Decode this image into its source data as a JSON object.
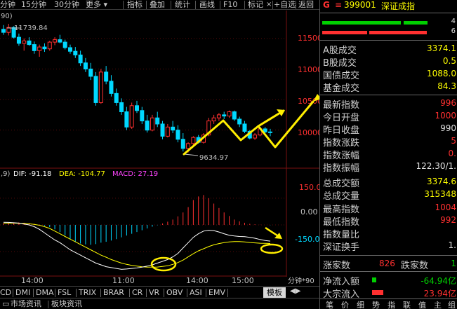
{
  "toolbar": {
    "items": [
      "分钟",
      "15分钟",
      "30分钟",
      "更多 ▾",
      "指标",
      "叠加",
      "统计",
      "画线",
      "F10",
      "标记",
      "+自选",
      "返回"
    ],
    "close_icon": "×"
  },
  "price_panel": {
    "period_label": "90)",
    "high_marker": "11739.84",
    "low_marker": "9634.97",
    "y_ticks": [
      "11500",
      "11000",
      "10500",
      "10000"
    ],
    "candle_up_color": "#ff3030",
    "candle_down_color": "#00d8ff"
  },
  "macd_panel": {
    "params": ",9)",
    "dif_label": "DIF: -91.18",
    "dea_label": "DEA: -104.77",
    "macd_label": "MACD: 27.19",
    "y_ticks": [
      "150.0",
      "0.00",
      "-150.0"
    ]
  },
  "x_axis": {
    "ticks": [
      "14:00",
      "11:00",
      "14:00",
      "15:00"
    ],
    "period_right": "分钟*90"
  },
  "indicator_tabs": [
    "CD",
    "DMI",
    "DMA",
    "FSL",
    "TRIX",
    "BRAR",
    "CR",
    "VR",
    "OBV",
    "ASI",
    "EMV"
  ],
  "template_button": "模板",
  "nav_arrows": "◀▶",
  "bottom_bar": {
    "items": [
      "市场资讯",
      "板块资讯"
    ]
  },
  "right_panel": {
    "indicator": "G",
    "menu_icon": "≡",
    "code": "399001",
    "name": "深证成指",
    "bar_counts": [
      "4",
      "6"
    ],
    "rows": [
      {
        "label": "A股成交",
        "value": "3374.1",
        "color": "#ffff00"
      },
      {
        "label": "B股成交",
        "value": "0.5",
        "color": "#ffff00"
      },
      {
        "label": "国债成交",
        "value": "1088.0",
        "color": "#ffff00"
      },
      {
        "label": "基金成交",
        "value": "84.3",
        "color": "#ffff00"
      },
      {
        "label": "最新指数",
        "value": "996",
        "color": "#ff3030"
      },
      {
        "label": "今日开盘",
        "value": "1000",
        "color": "#ff3030"
      },
      {
        "label": "昨日收盘",
        "value": "990",
        "color": "#e0e0e0"
      },
      {
        "label": "指数涨跌",
        "value": "5",
        "color": "#ff3030"
      },
      {
        "label": "指数涨幅",
        "value": "0.",
        "color": "#ff3030"
      },
      {
        "label": "指数振幅",
        "value": "122.30/1.",
        "color": "#e0e0e0"
      },
      {
        "label": "总成交额",
        "value": "3374.6",
        "color": "#ffff00"
      },
      {
        "label": "总成交量",
        "value": "315348",
        "color": "#ffff00"
      },
      {
        "label": "最高指数",
        "value": "1004",
        "color": "#ff3030"
      },
      {
        "label": "最低指数",
        "value": "992",
        "color": "#ff3030"
      },
      {
        "label": "指数量比",
        "value": "",
        "color": "#e0e0e0"
      },
      {
        "label": "深证换手",
        "value": "1.",
        "color": "#e0e0e0"
      }
    ],
    "up_count_label": "涨家数",
    "up_count": "826",
    "down_count_label": "跌家数",
    "down_count": "1",
    "net_inflow_label": "净流入额",
    "net_inflow": "-64.94亿",
    "big_inflow_label": "大宗流入",
    "big_inflow": "23.94亿"
  },
  "chart_data": {
    "type": "candlestick",
    "unit_note": "90-minute bars, index points",
    "ylim": [
      9400,
      11900
    ],
    "candles": [
      [
        11650,
        11720,
        11560,
        11600
      ],
      [
        11600,
        11739.84,
        11550,
        11680
      ],
      [
        11680,
        11700,
        11500,
        11520
      ],
      [
        11520,
        11580,
        11380,
        11420
      ],
      [
        11420,
        11500,
        11300,
        11460
      ],
      [
        11460,
        11520,
        11380,
        11400
      ],
      [
        11400,
        11450,
        11250,
        11300
      ],
      [
        11300,
        11400,
        11200,
        11360
      ],
      [
        11360,
        11420,
        11280,
        11330
      ],
      [
        11330,
        11460,
        11300,
        11440
      ],
      [
        11440,
        11520,
        11390,
        11480
      ],
      [
        11480,
        11560,
        11420,
        11440
      ],
      [
        11440,
        11480,
        11320,
        11350
      ],
      [
        11350,
        11400,
        11250,
        11290
      ],
      [
        11290,
        11360,
        11180,
        11230
      ],
      [
        11230,
        11300,
        11050,
        11100
      ],
      [
        11100,
        11180,
        10950,
        11000
      ],
      [
        11000,
        11100,
        10820,
        10880
      ],
      [
        10880,
        10950,
        10400,
        10450
      ],
      [
        10450,
        11000,
        10430,
        10950
      ],
      [
        10950,
        11050,
        10750,
        10800
      ],
      [
        10800,
        10900,
        10550,
        10600
      ],
      [
        10600,
        10680,
        10400,
        10450
      ],
      [
        10450,
        10520,
        10250,
        10300
      ],
      [
        10300,
        10380,
        10000,
        10050
      ],
      [
        10050,
        10450,
        10020,
        10400
      ],
      [
        10400,
        10480,
        10280,
        10320
      ],
      [
        10320,
        10380,
        10100,
        10150
      ],
      [
        10150,
        10250,
        9960,
        10000
      ],
      [
        10000,
        10250,
        9980,
        10200
      ],
      [
        10200,
        10300,
        10050,
        10100
      ],
      [
        10100,
        10150,
        9850,
        9900
      ],
      [
        9900,
        10100,
        9880,
        10050
      ],
      [
        10050,
        10150,
        9950,
        10000
      ],
      [
        10000,
        10080,
        9800,
        9850
      ],
      [
        9850,
        9950,
        9650,
        9700
      ],
      [
        9700,
        9800,
        9634.97,
        9780
      ],
      [
        9780,
        9900,
        9750,
        9880
      ],
      [
        9880,
        9920,
        9780,
        9800
      ],
      [
        9800,
        9950,
        9780,
        9920
      ],
      [
        9920,
        10200,
        9900,
        10150
      ],
      [
        10150,
        10250,
        10100,
        10200
      ],
      [
        10200,
        10280,
        10150,
        10250
      ],
      [
        10250,
        10300,
        10180,
        10230
      ],
      [
        10230,
        10320,
        10200,
        10300
      ],
      [
        10300,
        10320,
        10150,
        10180
      ],
      [
        10180,
        10220,
        10050,
        10100
      ],
      [
        10100,
        10150,
        9950,
        9980
      ],
      [
        9980,
        10000,
        9850,
        9870
      ],
      [
        9870,
        9950,
        9840,
        9920
      ],
      [
        9920,
        10050,
        9900,
        10020
      ],
      [
        10020,
        10050,
        9950,
        9970
      ],
      [
        9970,
        10020,
        9900,
        9960
      ]
    ],
    "macd": {
      "ylim": [
        -280,
        260
      ],
      "bars": [
        8,
        10,
        12,
        14,
        12,
        10,
        6,
        2,
        -4,
        -12,
        -25,
        -40,
        -58,
        -80,
        -95,
        -105,
        -110,
        -112,
        -108,
        -100,
        -95,
        -88,
        -80,
        -70,
        -60,
        -50,
        -40,
        -30,
        -20,
        -10,
        -2,
        8,
        18,
        30,
        48,
        70,
        100,
        140,
        160,
        168,
        150,
        120,
        95,
        70,
        50,
        30,
        20,
        12,
        6,
        3,
        1,
        0,
        -1
      ],
      "dif": [
        15,
        14,
        12,
        10,
        5,
        0,
        -10,
        -25,
        -45,
        -65,
        -85,
        -100,
        -120,
        -140,
        -155,
        -170,
        -185,
        -200,
        -215,
        -225,
        -235,
        -240,
        -245,
        -250,
        -248,
        -245,
        -242,
        -238,
        -232,
        -225,
        -215,
        -205,
        -195,
        -180,
        -160,
        -130,
        -100,
        -70,
        -50,
        -35,
        -30,
        -32,
        -40,
        -50,
        -58,
        -62,
        -65,
        -66,
        -70,
        -75,
        -82,
        -88,
        -91.18
      ],
      "dea": [
        10,
        10,
        10,
        9,
        8,
        6,
        3,
        -2,
        -10,
        -20,
        -35,
        -50,
        -65,
        -80,
        -95,
        -110,
        -125,
        -140,
        -155,
        -170,
        -182,
        -195,
        -205,
        -215,
        -222,
        -228,
        -232,
        -236,
        -238,
        -238,
        -237,
        -234,
        -230,
        -222,
        -212,
        -198,
        -180,
        -162,
        -146,
        -134,
        -122,
        -112,
        -105,
        -100,
        -96,
        -94,
        -94,
        -96,
        -99,
        -101,
        -103,
        -104,
        -104.77
      ]
    }
  }
}
